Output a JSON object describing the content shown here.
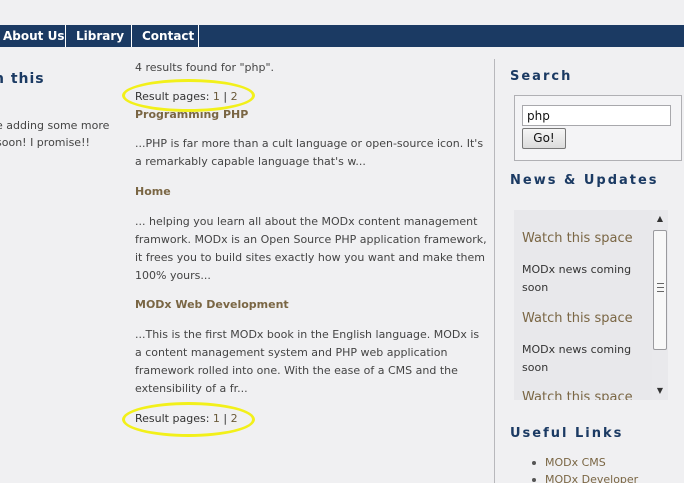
{
  "nav": {
    "items": [
      {
        "label": "About Us"
      },
      {
        "label": "Library"
      },
      {
        "label": "Contact"
      }
    ]
  },
  "left": {
    "heading_line1": "n this",
    "heading_line2": "!",
    "text_line1": "e adding some more",
    "text_line2": " soon! I promise!!"
  },
  "main": {
    "results_count": "4 results found for \"php\".",
    "pages_label": "Result pages: ",
    "page1": "1",
    "separator": " | ",
    "page2": "2",
    "results": [
      {
        "title": "Programming PHP",
        "snippet": "...PHP is far more than a cult language or open-source icon. It's a remarkably capable language that's w..."
      },
      {
        "title": "Home",
        "snippet": "... helping you learn all about the MODx content management framwork.  MODx is an Open Source PHP application framework, it frees you to build sites exactly how you want and make them 100% yours..."
      },
      {
        "title": "MODx Web Development",
        "snippet": "...This is the first MODx book in the English language.  MODx is a content management system and PHP web application framework rolled into one. With the ease of a CMS and the extensibility of a fr..."
      }
    ]
  },
  "sidebar": {
    "search_heading": "Search",
    "search_value": "php",
    "go_label": "Go!",
    "news_heading": "News & Updates",
    "news": [
      {
        "title": "Watch this space",
        "text": "MODx news coming soon"
      },
      {
        "title": "Watch this space",
        "text": "MODx news coming soon"
      },
      {
        "title": "Watch this space",
        "text": ""
      }
    ],
    "links_heading": "Useful Links",
    "links": [
      {
        "label": "MODx CMS"
      },
      {
        "label": "MODx Developer"
      }
    ]
  },
  "colors": {
    "nav_bg": "#1b3a63",
    "heading": "#1b3a63",
    "link": "#7a6644",
    "highlight_circle": "#f2f01a"
  }
}
